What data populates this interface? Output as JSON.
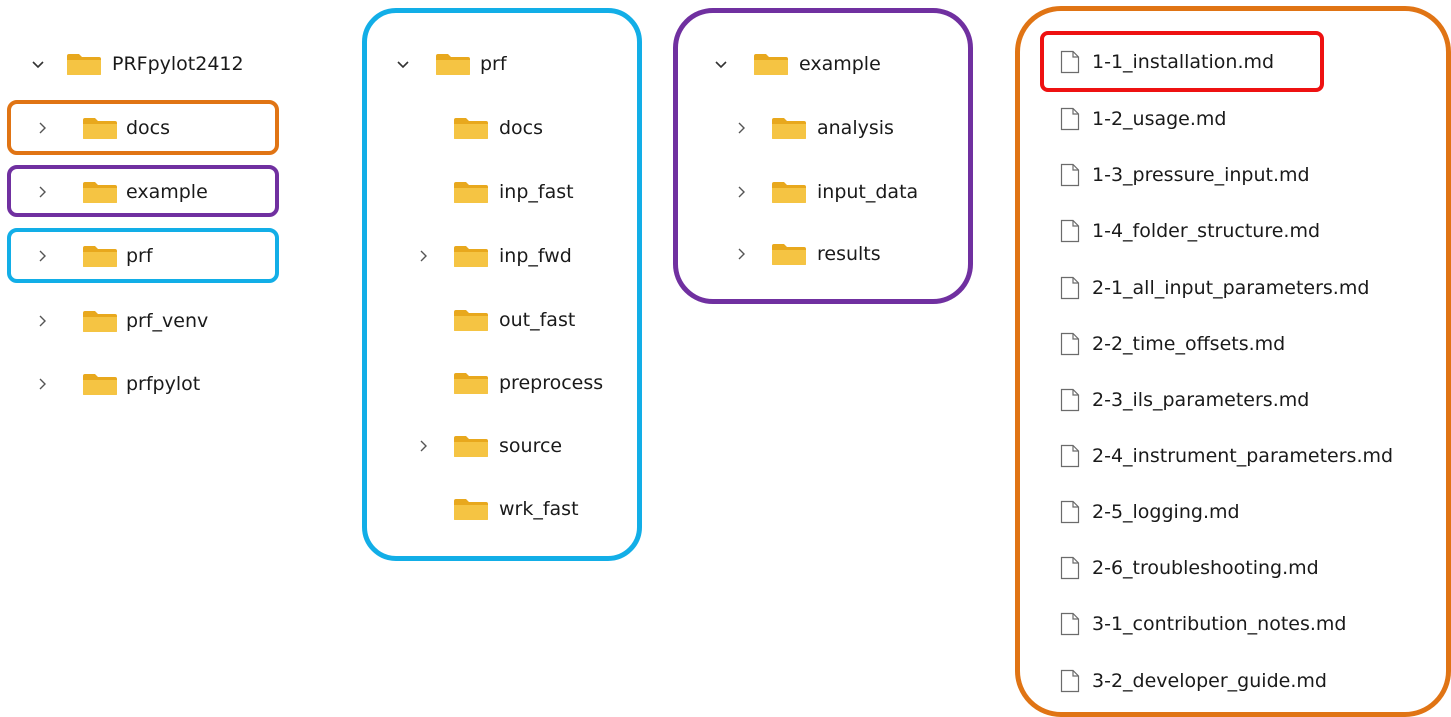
{
  "colors": {
    "orange": "#e07414",
    "purple": "#7030a0",
    "blue": "#12aee7",
    "red": "#ee1111",
    "folder": "#f5c443",
    "folder_dark": "#e8a81d"
  },
  "icons": {
    "folder": "folder-icon",
    "file": "file-icon",
    "chevron_right": "chevron-right-icon",
    "chevron_down": "chevron-down-icon"
  },
  "root_tree": {
    "root": {
      "label": "PRFpylot2412",
      "expanded": true
    },
    "children": [
      {
        "label": "docs",
        "expanded": false
      },
      {
        "label": "example",
        "expanded": false
      },
      {
        "label": "prf",
        "expanded": false
      },
      {
        "label": "prf_venv",
        "expanded": false
      },
      {
        "label": "prfpylot",
        "expanded": false
      }
    ]
  },
  "prf_tree": {
    "root": {
      "label": "prf",
      "expanded": true
    },
    "children": [
      {
        "label": "docs",
        "has_children": false
      },
      {
        "label": "inp_fast",
        "has_children": false
      },
      {
        "label": "inp_fwd",
        "has_children": true
      },
      {
        "label": "out_fast",
        "has_children": false
      },
      {
        "label": "preprocess",
        "has_children": false
      },
      {
        "label": "source",
        "has_children": true
      },
      {
        "label": "wrk_fast",
        "has_children": false
      }
    ]
  },
  "example_tree": {
    "root": {
      "label": "example",
      "expanded": true
    },
    "children": [
      {
        "label": "analysis",
        "has_children": true
      },
      {
        "label": "input_data",
        "has_children": true
      },
      {
        "label": "results",
        "has_children": true
      }
    ]
  },
  "docs_files": [
    "1-1_installation.md",
    "1-2_usage.md",
    "1-3_pressure_input.md",
    "1-4_folder_structure.md",
    "2-1_all_input_parameters.md",
    "2-2_time_offsets.md",
    "2-3_ils_parameters.md",
    "2-4_instrument_parameters.md",
    "2-5_logging.md",
    "2-6_troubleshooting.md",
    "3-1_contribution_notes.md",
    "3-2_developer_guide.md"
  ]
}
